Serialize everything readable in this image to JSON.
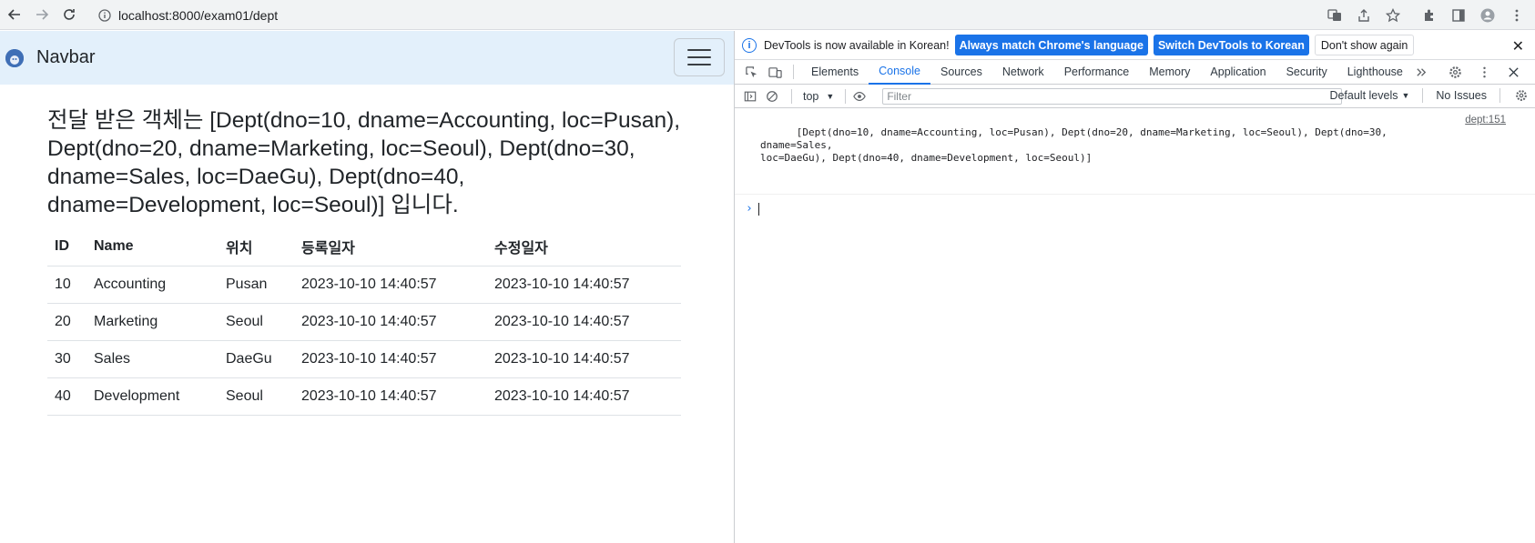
{
  "browser": {
    "url": "localhost:8000/exam01/dept"
  },
  "page": {
    "brand": "Navbar",
    "heading": "전달 받은 객체는 [Dept(dno=10, dname=Accounting, loc=Pusan), Dept(dno=20, dname=Marketing, loc=Seoul), Dept(dno=30, dname=Sales, loc=DaeGu), Dept(dno=40, dname=Development, loc=Seoul)] 입니다.",
    "table": {
      "headers": [
        "ID",
        "Name",
        "위치",
        "등록일자",
        "수정일자"
      ],
      "rows": [
        [
          "10",
          "Accounting",
          "Pusan",
          "2023-10-10 14:40:57",
          "2023-10-10 14:40:57"
        ],
        [
          "20",
          "Marketing",
          "Seoul",
          "2023-10-10 14:40:57",
          "2023-10-10 14:40:57"
        ],
        [
          "30",
          "Sales",
          "DaeGu",
          "2023-10-10 14:40:57",
          "2023-10-10 14:40:57"
        ],
        [
          "40",
          "Development",
          "Seoul",
          "2023-10-10 14:40:57",
          "2023-10-10 14:40:57"
        ]
      ]
    }
  },
  "devtools": {
    "infobar": {
      "message": "DevTools is now available in Korean!",
      "match_label": "Always match Chrome's language",
      "switch_label": "Switch DevTools to Korean",
      "dismiss_label": "Don't show again"
    },
    "tabs": [
      "Elements",
      "Console",
      "Sources",
      "Network",
      "Performance",
      "Memory",
      "Application",
      "Security",
      "Lighthouse"
    ],
    "active_tab": "Console",
    "console_toolbar": {
      "context": "top",
      "filter_placeholder": "Filter",
      "levels": "Default levels",
      "issues": "No Issues"
    },
    "log": {
      "message": "[Dept(dno=10, dname=Accounting, loc=Pusan), Dept(dno=20, dname=Marketing, loc=Seoul), Dept(dno=30, dname=Sales,\nloc=DaeGu), Dept(dno=40, dname=Development, loc=Seoul)]",
      "source": "dept:151"
    }
  },
  "colors": {
    "navbar_bg": "#e3f0fb",
    "accent": "#1a73e8"
  }
}
